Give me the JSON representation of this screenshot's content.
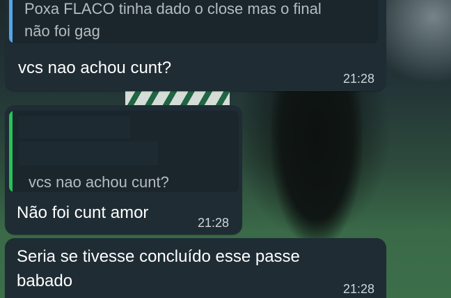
{
  "colors": {
    "bubble_incoming": "#1f2c34",
    "quote_bg": "#1a252c",
    "quote_bar_blue": "#53a6e8",
    "quote_bar_green": "#25c35c",
    "text_primary": "#ffffff",
    "text_quote": "#b4bcc1",
    "timestamp": "#cfd6da"
  },
  "messages": [
    {
      "quoted_text_line1": "Poxa FLACO tinha dado o close mas o final",
      "quoted_text_line2": "não foi gag",
      "text": "vcs nao achou cunt?",
      "time": "21:28"
    },
    {
      "quoted_text": "vcs nao achou cunt?",
      "text": "Não foi cunt amor",
      "time": "21:28"
    },
    {
      "text_line1": "Seria se tivesse concluído esse passe",
      "text_line2": "babado",
      "time": "21:28"
    }
  ]
}
